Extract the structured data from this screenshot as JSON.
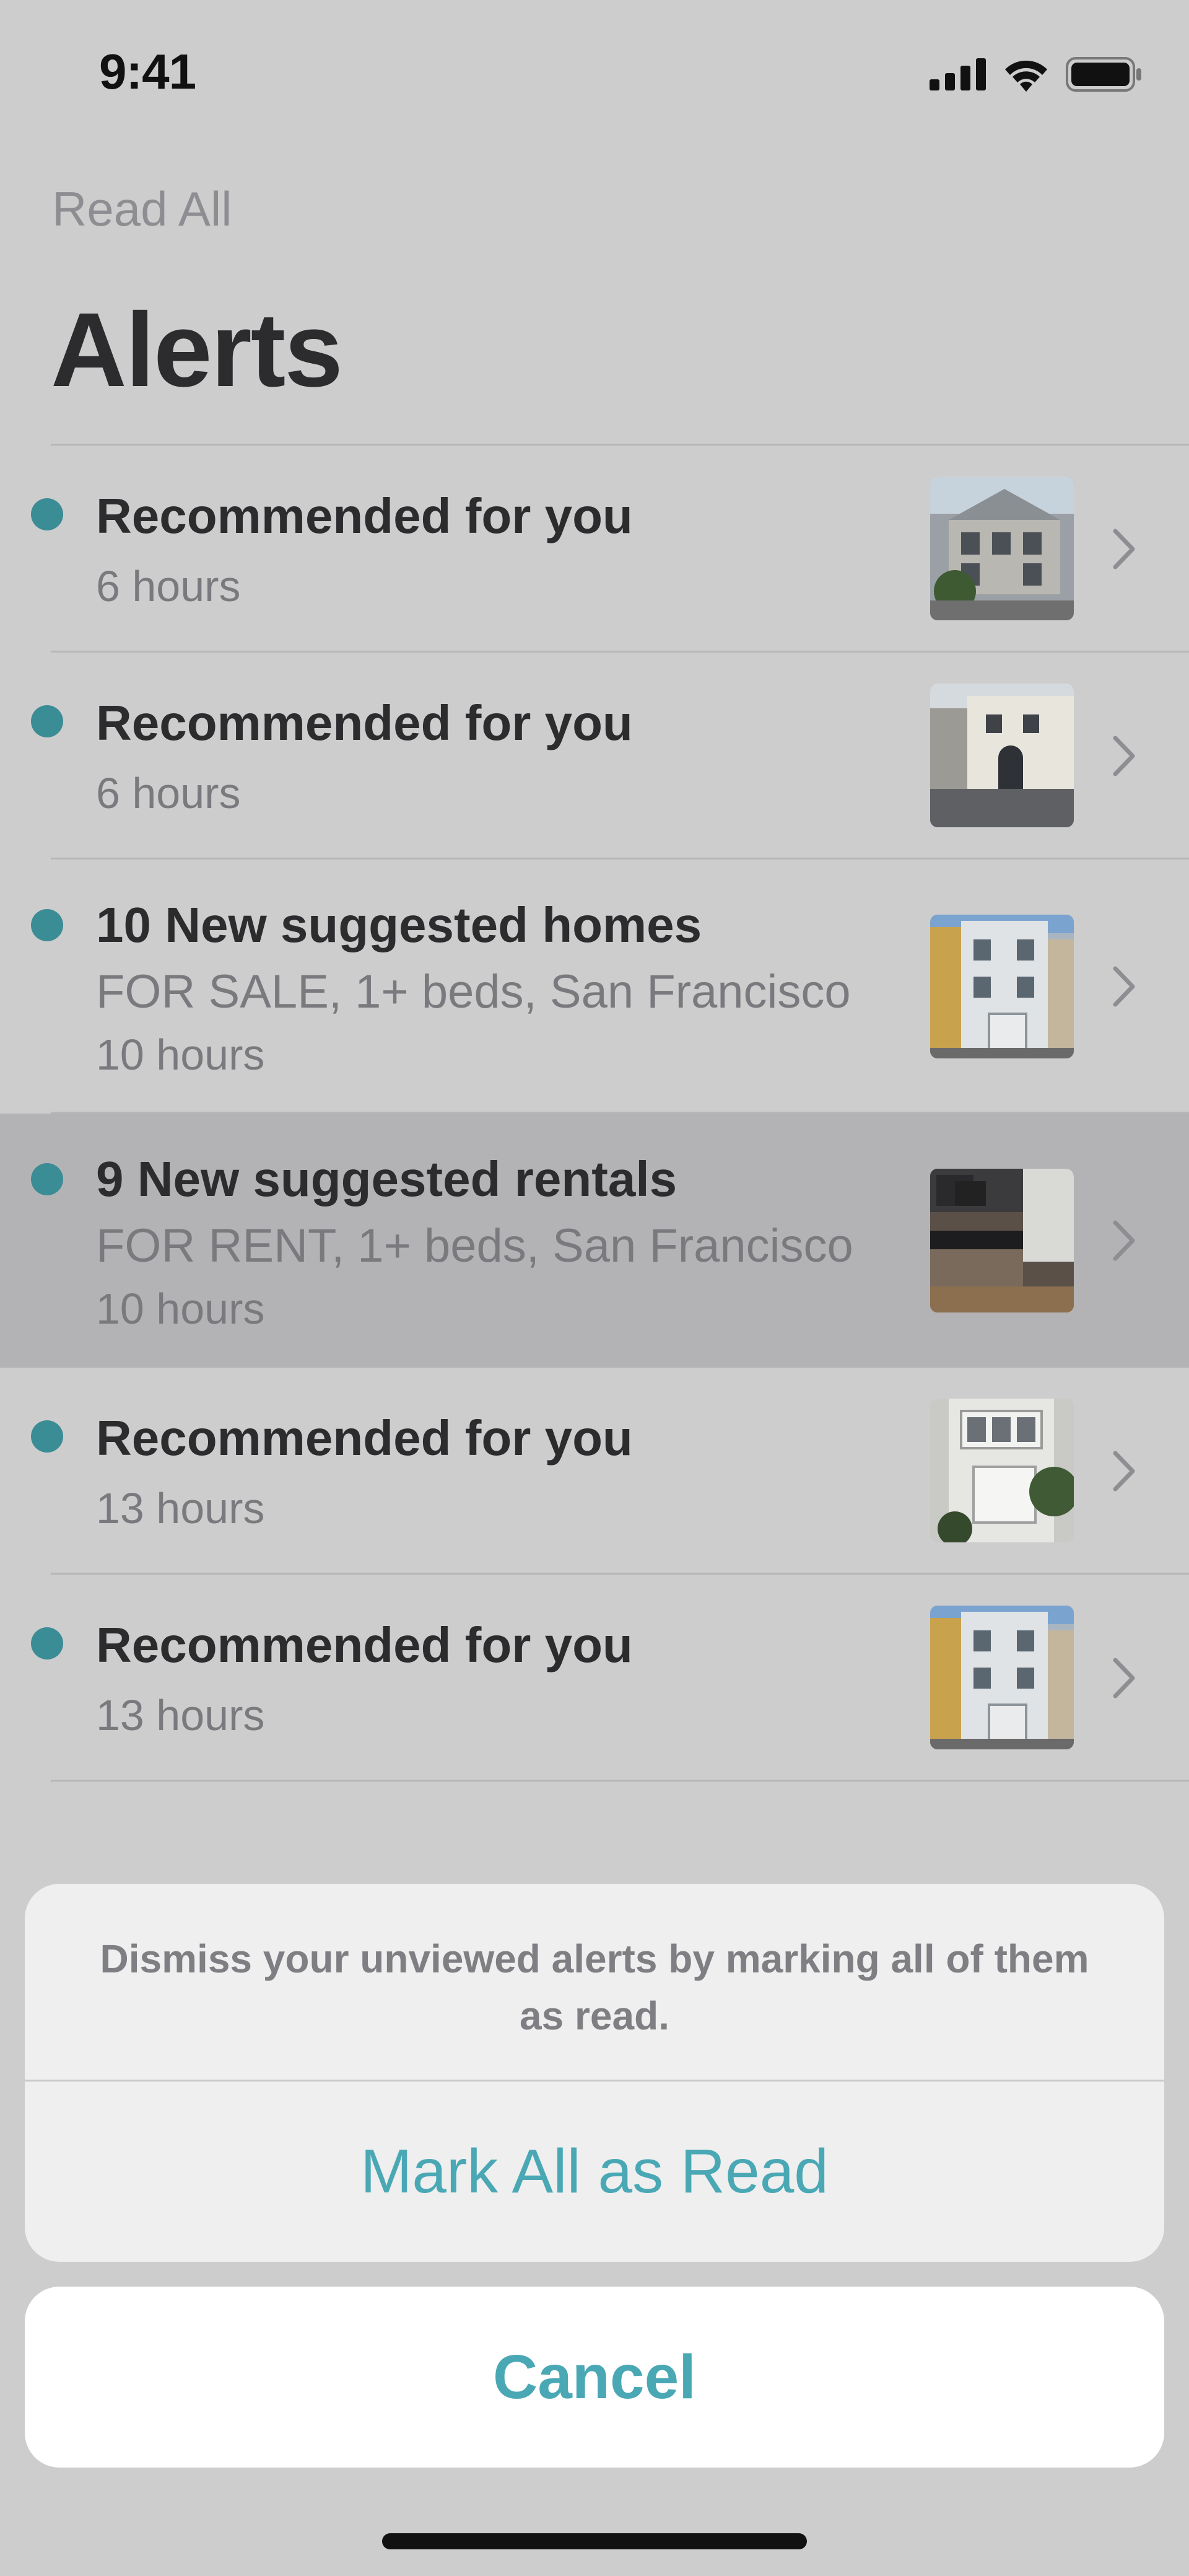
{
  "status_bar": {
    "time": "9:41",
    "icons": [
      "cellular-signal-icon",
      "wifi-icon",
      "battery-icon"
    ]
  },
  "header": {
    "read_all_label": "Read All",
    "title": "Alerts"
  },
  "alerts": [
    {
      "title": "Recommended for you",
      "subtitle": "",
      "time": "6 hours",
      "unread": true,
      "thumbnail": "house-photo"
    },
    {
      "title": "Recommended for you",
      "subtitle": "",
      "time": "6 hours",
      "unread": true,
      "thumbnail": "house-photo"
    },
    {
      "title": "10 New suggested homes",
      "subtitle": "FOR SALE, 1+ beds, San Francisco",
      "time": "10 hours",
      "unread": true,
      "thumbnail": "house-photo"
    },
    {
      "title": "9 New suggested rentals",
      "subtitle": "FOR RENT, 1+ beds, San Francisco",
      "time": "10 hours",
      "unread": true,
      "thumbnail": "kitchen-photo",
      "highlighted": true
    },
    {
      "title": "Recommended for you",
      "subtitle": "",
      "time": "13 hours",
      "unread": true,
      "thumbnail": "house-photo"
    },
    {
      "title": "Recommended for you",
      "subtitle": "",
      "time": "13 hours",
      "unread": true,
      "thumbnail": "house-photo"
    }
  ],
  "action_sheet": {
    "message": "Dismiss your unviewed alerts by marking all of them as read.",
    "mark_all_label": "Mark All as Read",
    "cancel_label": "Cancel"
  },
  "colors": {
    "accent": "#4aa8b5",
    "unread_dot": "#3a8c95",
    "dimmed_background": "#cdcdcd",
    "highlight_row": "#b3b3b5"
  }
}
